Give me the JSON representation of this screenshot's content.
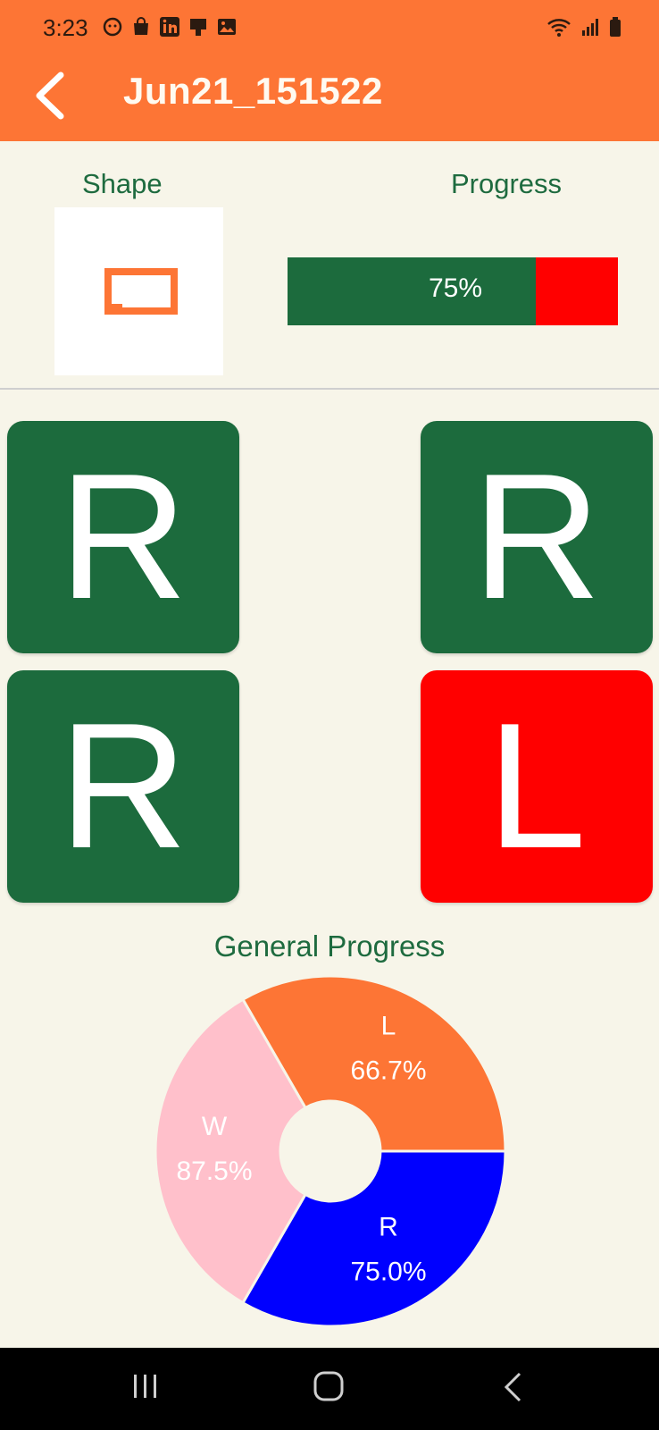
{
  "status": {
    "time": "3:23"
  },
  "header": {
    "title": "Jun21_151522"
  },
  "shape": {
    "label": "Shape"
  },
  "progress": {
    "label": "Progress",
    "value": 75,
    "text": "75%"
  },
  "tiles": [
    {
      "letter": "R",
      "state": "correct"
    },
    {
      "letter": "R",
      "state": "correct"
    },
    {
      "letter": "R",
      "state": "correct"
    },
    {
      "letter": "L",
      "state": "wrong"
    }
  ],
  "general_progress": {
    "title": "General Progress",
    "slices": [
      {
        "label": "L",
        "text": "66.7%",
        "color": "#fd7535"
      },
      {
        "label": "R",
        "text": "75.0%",
        "color": "#0000ff"
      },
      {
        "label": "W",
        "text": "87.5%",
        "color": "#ffc0cb"
      }
    ]
  },
  "colors": {
    "appbar": "#fd7535",
    "correct": "#1c6b3d",
    "wrong": "#ff0000",
    "background": "#f7f5e9"
  }
}
